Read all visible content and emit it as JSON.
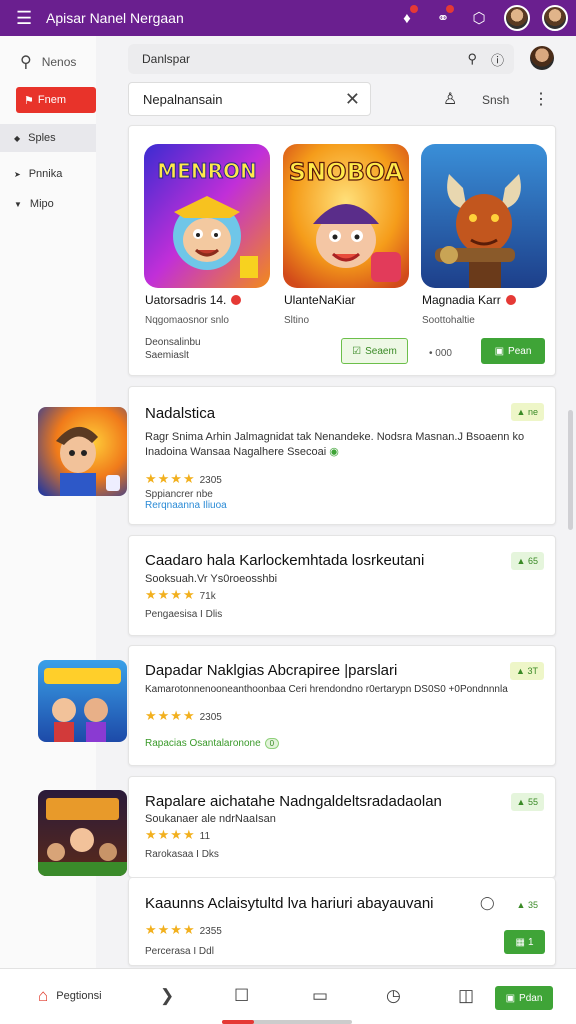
{
  "topbar": {
    "title": "Apisar Nanel Nergaan",
    "icons": [
      "menu-icon",
      "bell-icon",
      "chat-icon",
      "shield-icon",
      "avatar",
      "avatar"
    ]
  },
  "sidebar": {
    "search_label": "Nenos",
    "primary_button": "Fnem",
    "items": [
      {
        "label": "Sples",
        "active": true
      },
      {
        "label": "Pnnika",
        "active": false
      },
      {
        "label": "Mipo",
        "active": false
      }
    ]
  },
  "search": {
    "text": "Danlspar"
  },
  "filter": {
    "text": "Nepalnansain",
    "share_label": "Snsh"
  },
  "featured": {
    "apps": [
      {
        "name": "Uatorsadris 14.",
        "sub": "Nqgomaosnor snlo",
        "line1": "Deonsalinbu",
        "line2": "Saemiaslt",
        "art_text": "MENRON"
      },
      {
        "name": "UlanteNaKiar",
        "sub": "Sltino",
        "button": "Seaem",
        "small": "",
        "art_text": "SNOBOA"
      },
      {
        "name": "Magnadia Karr",
        "sub": "Soottohaltie",
        "small": "000",
        "button": "Pean",
        "art_text": ""
      }
    ]
  },
  "list": [
    {
      "title": "Nadalstica",
      "desc": "Ragr Snima Arhin Jalmagnidat tak Nenandeke. Nodsra Masnan.J Bsoaenn ko Inadoina Wansaa Nagalhere Ssecoai",
      "rating": "2305",
      "meta": "Sppiancrer nbe",
      "link": "Rerqnaanna Iliuoa",
      "badge": "ne"
    },
    {
      "title": "Caadaro hala Karlockemhtada losrkeutani",
      "sub": "Sooksuah.Vr Ys0roeosshbi",
      "rating": "71k",
      "meta": "Pengaesisa I Dlis",
      "badge": "65"
    },
    {
      "title": "Dapadar Naklgias Abcrapiree |parslari",
      "desc": "Kamarotonnenooneanthoonbaa Ceri hrendondno r0ertarypn DS0S0 +0Pondnnnla",
      "rating": "2305",
      "link": "Rapacias Osantalaronone",
      "link_pill": "0",
      "badge": "3T"
    },
    {
      "title": "Rapalare aichatahe Nadngaldeltsradadaolan",
      "sub": "Soukanaer ale ndrNaaIsan",
      "rating": "11",
      "meta": "Rarokasaa I Dks",
      "badge": "55"
    },
    {
      "title": "Kaaunns Aclaisytultd lva hariuri abayauvani",
      "rating": "2355",
      "meta": "Percerasa I Ddl",
      "badge": "35",
      "button": "1"
    }
  ],
  "bottombar": {
    "home_label": "Pegtionsi",
    "button": "Pdan"
  }
}
